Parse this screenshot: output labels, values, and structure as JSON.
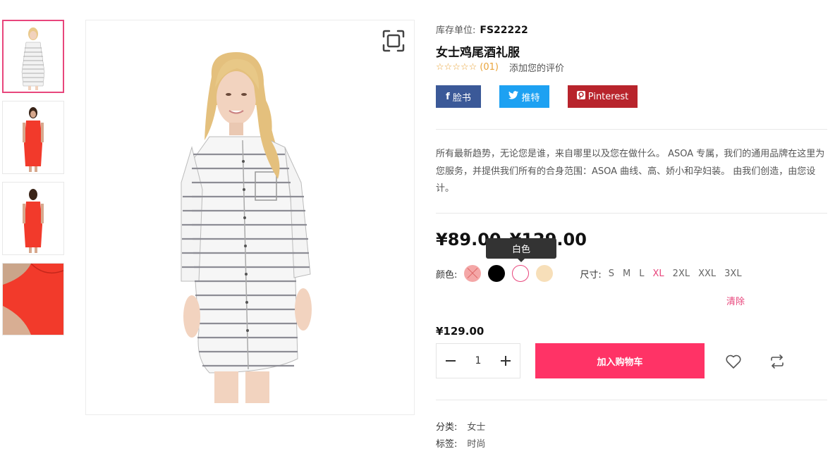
{
  "thumbnails": [
    {
      "name": "thumb-striped-dress",
      "alt": "白色条纹衬衫裙"
    },
    {
      "name": "thumb-red-dress-front",
      "alt": "红色连衣裙正面"
    },
    {
      "name": "thumb-red-dress-back",
      "alt": "红色连衣裙背面"
    },
    {
      "name": "thumb-red-dress-detail",
      "alt": "红色连衣裙细节"
    }
  ],
  "product": {
    "sku_label": "库存单位:",
    "sku_value": "FS22222",
    "title": "女士鸡尾酒礼服",
    "stars": "☆☆☆☆☆",
    "rating_count": "(01)",
    "add_review": "添加您的评价",
    "description": "所有最新趋势，无论您是谁，来自哪里以及您在做什么。 ASOA 专属，我们的通用品牌在这里为您服务，并提供我们所有的合身范围：ASOA 曲线、高、娇小和孕妇装。 由我们创造，由您设计。",
    "price_range": "¥89.00–¥129.00",
    "price": "¥129.00"
  },
  "share": {
    "facebook": "脸书",
    "twitter": "推特",
    "pinterest": "Pinterest"
  },
  "options": {
    "color_label": "颜色:",
    "tooltip": "白色",
    "size_label": "尺寸:",
    "sizes": [
      "S",
      "M",
      "L",
      "XL",
      "2XL",
      "XXL",
      "3XL"
    ],
    "selected_size": "XL",
    "clear": "清除"
  },
  "cart": {
    "quantity": "1",
    "add_to_cart": "加入购物车"
  },
  "meta": {
    "category_label": "分类:",
    "category_value": "女士",
    "tags_label": "标签:",
    "tags_value": "时尚"
  },
  "colors": {
    "accent": "#ff3366",
    "facebook": "#3b5998",
    "twitter": "#1da1f2",
    "pinterest": "#b8242c",
    "rating": "#e9a43b"
  }
}
